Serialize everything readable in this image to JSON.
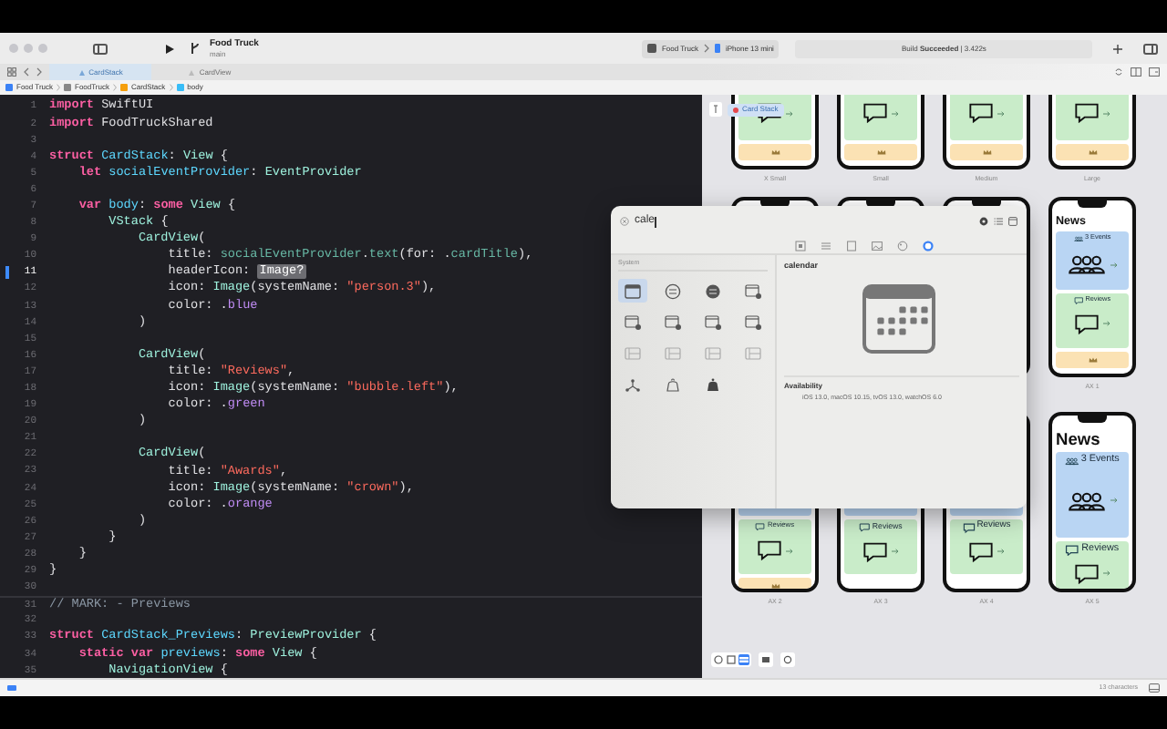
{
  "toolbar": {
    "project": "Food Truck",
    "branch": "main",
    "scheme": "Food Truck",
    "device": "iPhone 13 mini",
    "build_status": "Build **Succeeded** | 3.422s"
  },
  "tabs": [
    {
      "label": "CardStack",
      "selected": true
    },
    {
      "label": "CardView",
      "selected": false
    }
  ],
  "breadcrumb": [
    "Food Truck",
    "FoodTruck",
    "CardStack",
    "body"
  ],
  "code": {
    "lines": [
      {
        "n": "1",
        "current": false,
        "spans": [
          {
            "kind": "kw",
            "text": "import"
          },
          {
            "kind": "plain",
            "text": " SwiftUI"
          }
        ]
      },
      {
        "n": "2",
        "current": false,
        "spans": [
          {
            "kind": "kw",
            "text": "import"
          },
          {
            "kind": "plain",
            "text": " FoodTruckShared"
          }
        ]
      },
      {
        "n": "3",
        "current": false
      },
      {
        "n": "4",
        "current": false,
        "spans": [
          {
            "kind": "kw",
            "text": "struct"
          },
          {
            "kind": "decl",
            "text": " CardStack"
          },
          {
            "kind": "plain",
            "text": ":"
          },
          {
            "kind": "type",
            "text": " View"
          },
          {
            "kind": "plain",
            "text": " {"
          }
        ]
      },
      {
        "n": "5",
        "current": false,
        "spans": [
          {
            "kind": "kw",
            "text": "    let"
          },
          {
            "kind": "decl",
            "text": " socialEventProvider"
          },
          {
            "kind": "plain",
            "text": ":"
          },
          {
            "kind": "type",
            "text": " EventProvider"
          }
        ]
      },
      {
        "n": "6",
        "current": false
      },
      {
        "n": "7",
        "current": false,
        "spans": [
          {
            "kind": "kw",
            "text": "    var"
          },
          {
            "kind": "decl",
            "text": " body"
          },
          {
            "kind": "plain",
            "text": ":"
          },
          {
            "kind": "kw",
            "text": " some"
          },
          {
            "kind": "type",
            "text": " View"
          },
          {
            "kind": "plain",
            "text": " {"
          }
        ]
      },
      {
        "n": "8",
        "current": false,
        "spans": [
          {
            "kind": "type",
            "text": "        VStack"
          },
          {
            "kind": "plain",
            "text": " {"
          }
        ]
      },
      {
        "n": "9",
        "current": false,
        "spans": [
          {
            "kind": "type",
            "text": "            CardView"
          },
          {
            "kind": "plain",
            "text": "("
          }
        ]
      },
      {
        "n": "10",
        "current": false,
        "spans": [
          {
            "kind": "plain",
            "text": "                title:"
          },
          {
            "kind": "member",
            "text": " socialEventProvider"
          },
          {
            "kind": "plain",
            "text": "."
          },
          {
            "kind": "member",
            "text": "text"
          },
          {
            "kind": "plain",
            "text": "(for: ."
          },
          {
            "kind": "member",
            "text": "cardTitle"
          },
          {
            "kind": "plain",
            "text": "),"
          }
        ]
      },
      {
        "n": "11",
        "current": true,
        "spans": [
          {
            "kind": "plain",
            "text": "                headerIcon:"
          },
          {
            "kind": "placeholder",
            "text": "Image?"
          }
        ]
      },
      {
        "n": "12",
        "current": false,
        "spans": [
          {
            "kind": "plain",
            "text": "                icon:"
          },
          {
            "kind": "type",
            "text": " Image"
          },
          {
            "kind": "plain",
            "text": "(systemName:"
          },
          {
            "kind": "str",
            "text": " \"person.3\""
          },
          {
            "kind": "plain",
            "text": "),"
          }
        ]
      },
      {
        "n": "13",
        "current": false,
        "spans": [
          {
            "kind": "plain",
            "text": "                color: ."
          },
          {
            "kind": "enum",
            "text": "blue"
          }
        ]
      },
      {
        "n": "14",
        "current": false,
        "spans": [
          {
            "kind": "plain",
            "text": "            )"
          }
        ]
      },
      {
        "n": "15",
        "current": false
      },
      {
        "n": "16",
        "current": false,
        "spans": [
          {
            "kind": "type",
            "text": "            CardView"
          },
          {
            "kind": "plain",
            "text": "("
          }
        ]
      },
      {
        "n": "17",
        "current": false,
        "spans": [
          {
            "kind": "plain",
            "text": "                title:"
          },
          {
            "kind": "str",
            "text": " \"Reviews\""
          },
          {
            "kind": "plain",
            "text": ","
          }
        ]
      },
      {
        "n": "18",
        "current": false,
        "spans": [
          {
            "kind": "plain",
            "text": "                icon:"
          },
          {
            "kind": "type",
            "text": " Image"
          },
          {
            "kind": "plain",
            "text": "(systemName:"
          },
          {
            "kind": "str",
            "text": " \"bubble.left\""
          },
          {
            "kind": "plain",
            "text": "),"
          }
        ]
      },
      {
        "n": "19",
        "current": false,
        "spans": [
          {
            "kind": "plain",
            "text": "                color: ."
          },
          {
            "kind": "enum",
            "text": "green"
          }
        ]
      },
      {
        "n": "20",
        "current": false,
        "spans": [
          {
            "kind": "plain",
            "text": "            )"
          }
        ]
      },
      {
        "n": "21",
        "current": false
      },
      {
        "n": "22",
        "current": false,
        "spans": [
          {
            "kind": "type",
            "text": "            CardView"
          },
          {
            "kind": "plain",
            "text": "("
          }
        ]
      },
      {
        "n": "23",
        "current": false,
        "spans": [
          {
            "kind": "plain",
            "text": "                title:"
          },
          {
            "kind": "str",
            "text": " \"Awards\""
          },
          {
            "kind": "plain",
            "text": ","
          }
        ]
      },
      {
        "n": "24",
        "current": false,
        "spans": [
          {
            "kind": "plain",
            "text": "                icon:"
          },
          {
            "kind": "type",
            "text": " Image"
          },
          {
            "kind": "plain",
            "text": "(systemName:"
          },
          {
            "kind": "str",
            "text": " \"crown\""
          },
          {
            "kind": "plain",
            "text": "),"
          }
        ]
      },
      {
        "n": "25",
        "current": false,
        "spans": [
          {
            "kind": "plain",
            "text": "                color: ."
          },
          {
            "kind": "enum",
            "text": "orange"
          }
        ]
      },
      {
        "n": "26",
        "current": false,
        "spans": [
          {
            "kind": "plain",
            "text": "            )"
          }
        ]
      },
      {
        "n": "27",
        "current": false,
        "spans": [
          {
            "kind": "plain",
            "text": "        }"
          }
        ]
      },
      {
        "n": "28",
        "current": false,
        "spans": [
          {
            "kind": "plain",
            "text": "    }"
          }
        ]
      },
      {
        "n": "29",
        "current": false,
        "spans": [
          {
            "kind": "plain",
            "text": "}"
          }
        ]
      },
      {
        "n": "30",
        "current": false
      },
      {
        "n": "31",
        "current": false,
        "spans": [
          {
            "kind": "comment",
            "text": "// MARK: - Previews"
          }
        ]
      },
      {
        "n": "32",
        "current": false
      },
      {
        "n": "33",
        "current": false,
        "spans": [
          {
            "kind": "kw",
            "text": "struct"
          },
          {
            "kind": "decl",
            "text": " CardStack_Previews"
          },
          {
            "kind": "plain",
            "text": ":"
          },
          {
            "kind": "type",
            "text": " PreviewProvider"
          },
          {
            "kind": "plain",
            "text": " {"
          }
        ]
      },
      {
        "n": "34",
        "current": false,
        "spans": [
          {
            "kind": "kw",
            "text": "    static var"
          },
          {
            "kind": "decl",
            "text": " previews"
          },
          {
            "kind": "plain",
            "text": ":"
          },
          {
            "kind": "kw",
            "text": " some"
          },
          {
            "kind": "type",
            "text": " View"
          },
          {
            "kind": "plain",
            "text": " {"
          }
        ]
      },
      {
        "n": "35",
        "current": false,
        "spans": [
          {
            "kind": "type",
            "text": "        NavigationView"
          },
          {
            "kind": "plain",
            "text": " {"
          }
        ]
      }
    ]
  },
  "symbols_popup": {
    "search": "cale",
    "categories": [
      {
        "kind": "square",
        "selected": false
      },
      {
        "kind": "list",
        "selected": false
      },
      {
        "kind": "panel",
        "selected": false
      },
      {
        "kind": "photo",
        "selected": false
      },
      {
        "kind": "palette",
        "selected": false
      },
      {
        "kind": "symbol",
        "selected": true
      }
    ],
    "section": "System",
    "symbols": [
      {
        "kind": "calendar",
        "selected": true
      },
      {
        "kind": "disc",
        "selected": false
      },
      {
        "kind": "disc_fill",
        "selected": false
      },
      {
        "kind": "window_badge",
        "selected": false
      },
      {
        "kind": "window_badge",
        "selected": false
      },
      {
        "kind": "window_badge",
        "selected": false
      },
      {
        "kind": "window_badge",
        "selected": false
      },
      {
        "kind": "window_badge",
        "selected": false
      },
      {
        "kind": "split",
        "selected": false
      },
      {
        "kind": "split",
        "selected": false
      },
      {
        "kind": "split",
        "selected": false
      },
      {
        "kind": "split",
        "selected": false
      },
      {
        "kind": "nodes",
        "selected": false
      },
      {
        "kind": "bell",
        "selected": false
      },
      {
        "kind": "bell_fill",
        "selected": false
      }
    ],
    "detail_name": "calendar",
    "availability_heading": "Availability",
    "availability": "iOS 13.0, macOS 10.15, tvOS 13.0, watchOS 6.0"
  },
  "preview": {
    "pinned": "Card Stack",
    "rows": [
      [
        {
          "label": "X Small",
          "cards": [
            {
              "kind": "reviews"
            },
            {
              "kind": "awards"
            }
          ]
        },
        {
          "label": "Small",
          "cards": [
            {
              "kind": "reviews"
            },
            {
              "kind": "awards"
            }
          ]
        },
        {
          "label": "Medium",
          "cards": [
            {
              "kind": "reviews"
            },
            {
              "kind": "awards"
            }
          ]
        },
        {
          "label": "Large",
          "cards": [
            {
              "kind": "reviews"
            },
            {
              "kind": "awards"
            }
          ]
        }
      ],
      [
        {},
        {},
        {},
        {
          "label": "AX 1",
          "cards": [
            {
              "kind": "title",
              "text": "News"
            },
            {
              "kind": "events",
              "text": "3 Events"
            },
            {
              "kind": "reviews",
              "text": "Reviews"
            },
            {
              "kind": "awards"
            }
          ]
        }
      ],
      [
        {
          "label": "AX 2",
          "cards": [
            {
              "kind": "events"
            },
            {
              "kind": "reviews",
              "text": "Reviews"
            },
            {
              "kind": "awards"
            }
          ]
        },
        {
          "label": "AX 3",
          "cards": [
            {
              "kind": "events"
            },
            {
              "kind": "reviews",
              "text": "Reviews"
            }
          ]
        },
        {
          "label": "AX 4",
          "cards": [
            {
              "kind": "events"
            },
            {
              "kind": "reviews",
              "text": "Reviews"
            }
          ]
        },
        {
          "label": "AX 5",
          "cards": [
            {
              "kind": "title",
              "text": "News"
            },
            {
              "kind": "events",
              "text": "3 Events"
            },
            {
              "kind": "reviews",
              "text": "Reviews"
            }
          ]
        }
      ]
    ],
    "modes": [
      {
        "kind": "live",
        "selected": false
      },
      {
        "kind": "select",
        "selected": false
      },
      {
        "kind": "variants",
        "selected": true
      }
    ]
  },
  "status_bar": {
    "characters": "13 characters"
  }
}
